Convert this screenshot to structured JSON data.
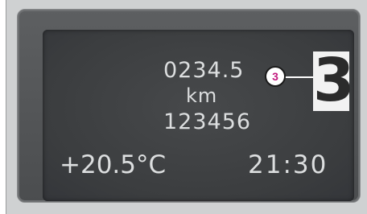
{
  "display": {
    "trip_odometer": "0234.5",
    "distance_unit": "km",
    "total_odometer": "123456",
    "outside_temperature": "+20.5°C",
    "clock": "21:30",
    "gear": "3"
  },
  "annotation": {
    "callout_number": "3",
    "callout_color": "#c2187e"
  }
}
